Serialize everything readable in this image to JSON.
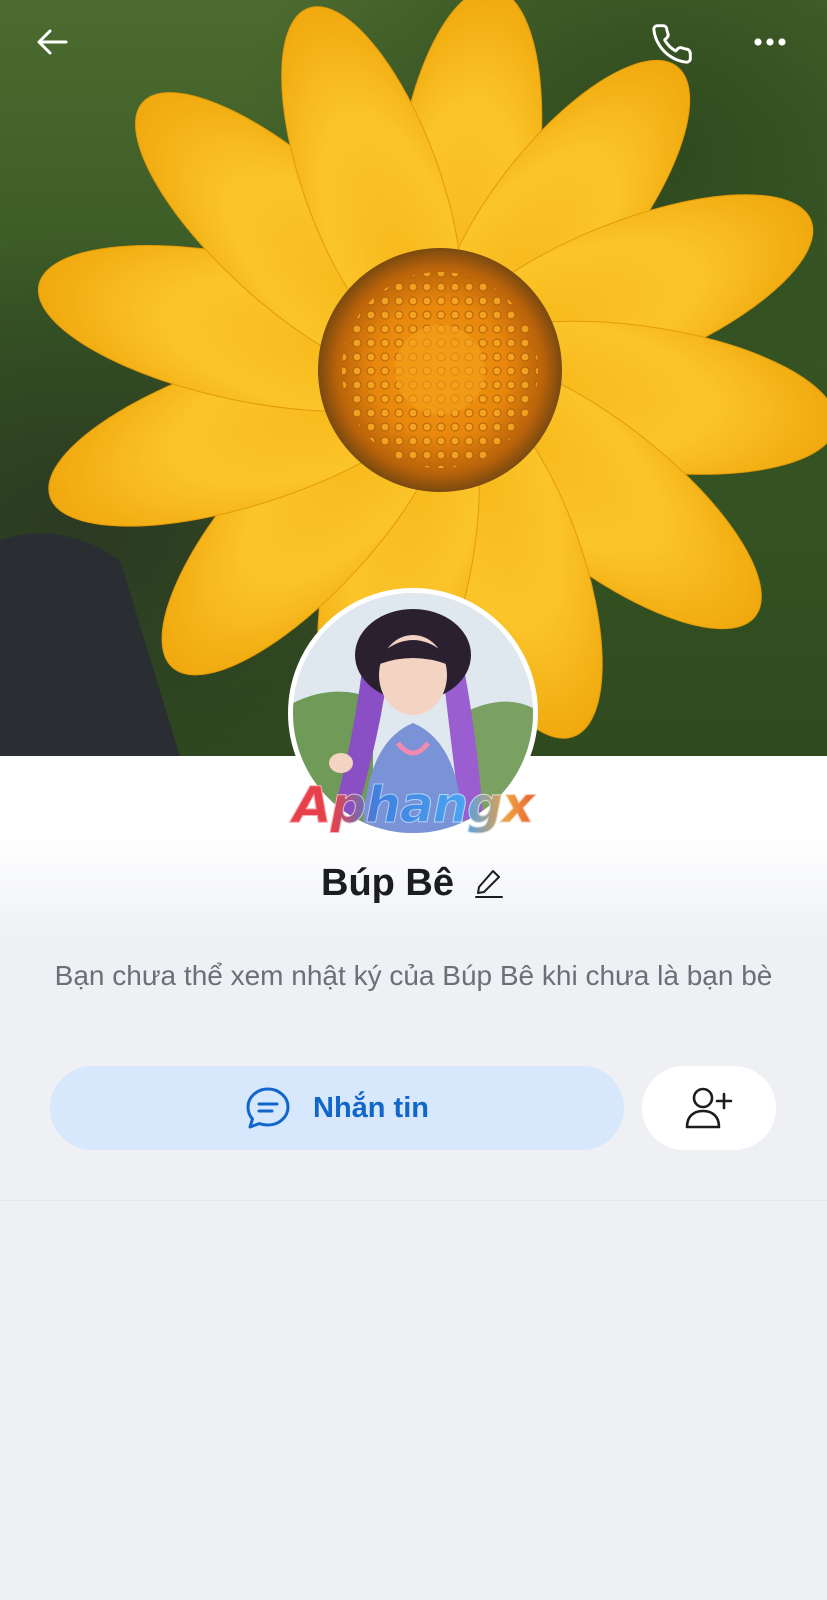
{
  "header": {
    "back_icon": "arrow-left-icon",
    "call_icon": "phone-icon",
    "more_icon": "more-horizontal-icon"
  },
  "profile": {
    "name": "Búp Bê",
    "watermark": "Aphangx",
    "notice": "Bạn chưa thể xem nhật ký của Búp Bê khi chưa là bạn bè"
  },
  "actions": {
    "message_label": "Nhắn tin",
    "message_icon": "chat-bubble-icon",
    "add_friend_icon": "add-friend-icon"
  },
  "colors": {
    "accent": "#1166cc",
    "message_button_bg": "#d7e8fc",
    "background": "#eef0f4"
  }
}
